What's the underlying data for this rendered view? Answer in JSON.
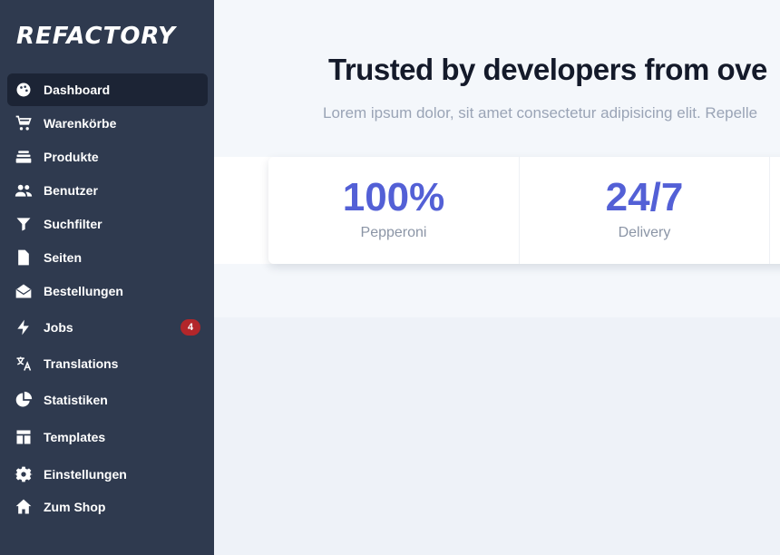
{
  "brand": {
    "logo_text": "REFACTORY"
  },
  "sidebar": {
    "items": [
      {
        "label": "Dashboard",
        "icon": "palette-icon",
        "active": true
      },
      {
        "label": "Warenkörbe",
        "icon": "cart-icon"
      },
      {
        "label": "Produkte",
        "icon": "stack-icon"
      },
      {
        "label": "Benutzer",
        "icon": "users-icon"
      },
      {
        "label": "Suchfilter",
        "icon": "filter-icon"
      },
      {
        "label": "Seiten",
        "icon": "file-icon"
      },
      {
        "label": "Bestellungen",
        "icon": "envelope-open-icon"
      },
      {
        "label": "Jobs",
        "icon": "bolt-icon",
        "badge": "4"
      },
      {
        "label": "Translations",
        "icon": "translate-icon"
      },
      {
        "label": "Statistiken",
        "icon": "pie-chart-icon"
      },
      {
        "label": "Templates",
        "icon": "layout-icon"
      },
      {
        "label": "Einstellungen",
        "icon": "gear-icon"
      },
      {
        "label": "Zum Shop",
        "icon": "home-icon"
      }
    ]
  },
  "hero": {
    "headline": "Trusted by developers from ove",
    "subline": "Lorem ipsum dolor, sit amet consectetur adipisicing elit. Repelle"
  },
  "stats": [
    {
      "value": "100%",
      "label": "Pepperoni"
    },
    {
      "value": "24/7",
      "label": "Delivery"
    }
  ],
  "colors": {
    "sidebar_bg": "#2f3a4f",
    "active_bg": "#1c2435",
    "accent": "#5360d6",
    "badge": "#b3262a"
  }
}
